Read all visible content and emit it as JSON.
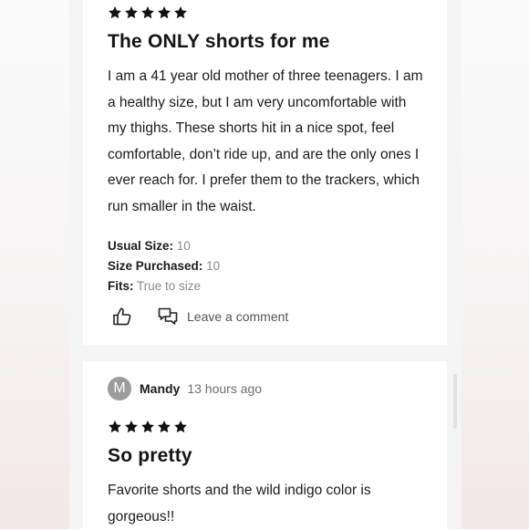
{
  "reviews": [
    {
      "rating": 5,
      "title": "The ONLY shorts for me",
      "body_lines": [
        "I am a 41 year old mother of three teenagers. I am",
        "a healthy size, but I am very uncomfortable with",
        "my thighs. These shorts hit in a nice spot, feel",
        "comfortable, don’t ride up, and are the only ones I",
        "ever reach for. I prefer them to the trackers, which",
        "run smaller in the waist."
      ],
      "usual_size_label": "Usual Size:",
      "usual_size": "10",
      "size_purchased_label": "Size Purchased:",
      "size_purchased": "10",
      "fits_label": "Fits:",
      "fits": "True to size",
      "comment_label": "Leave a comment"
    },
    {
      "rating": 5,
      "reviewer_initial": "M",
      "reviewer_name": "Mandy",
      "time_ago": "13 hours ago",
      "title": "So pretty",
      "body_lines": [
        "Favorite shorts and the wild indigo color is",
        "gorgeous!!"
      ]
    }
  ],
  "icons": {
    "star": "star-icon",
    "like": "thumbs-up-icon",
    "comment": "speech-bubbles-icon"
  },
  "colors": {
    "star": "#111111",
    "avatar": "#9c9c9c",
    "muted_text": "#8a8a8a"
  }
}
